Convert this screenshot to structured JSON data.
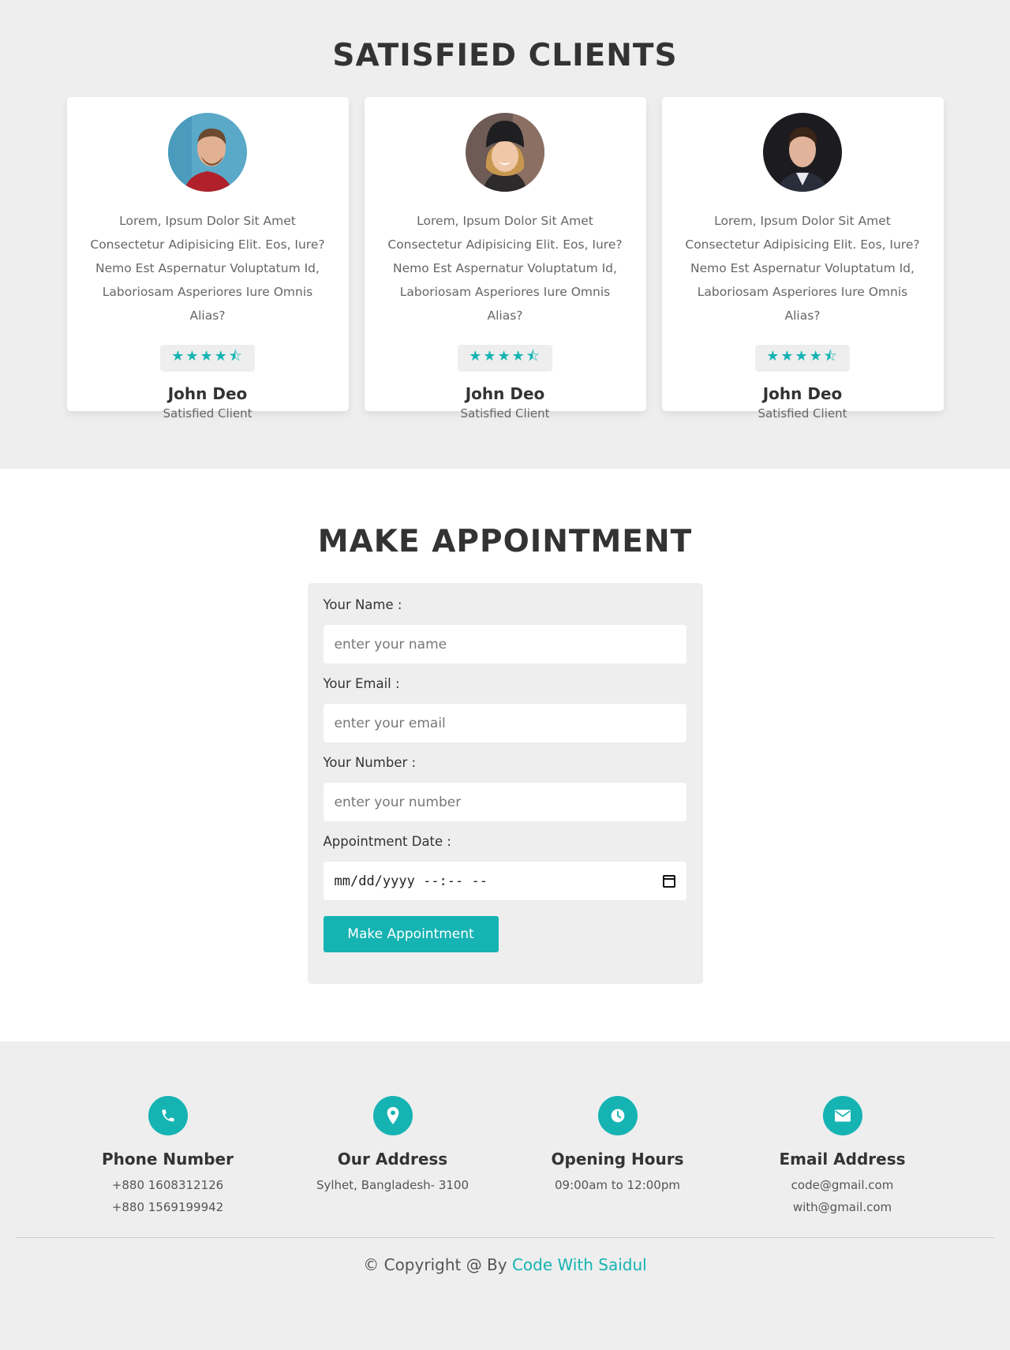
{
  "clients": {
    "title": "SATISFIED CLIENTS",
    "cards": [
      {
        "text": "Lorem, Ipsum Dolor Sit Amet Consectetur Adipisicing Elit. Eos, Iure? Nemo Est Aspernatur Voluptatum Id, Laboriosam Asperiores Iure Omnis Alias?",
        "rating": 4.5,
        "stars": "★★★★⯪",
        "name": "John Deo",
        "role": "Satisfied Client"
      },
      {
        "text": "Lorem, Ipsum Dolor Sit Amet Consectetur Adipisicing Elit. Eos, Iure? Nemo Est Aspernatur Voluptatum Id, Laboriosam Asperiores Iure Omnis Alias?",
        "rating": 4.5,
        "stars": "★★★★⯪",
        "name": "John Deo",
        "role": "Satisfied Client"
      },
      {
        "text": "Lorem, Ipsum Dolor Sit Amet Consectetur Adipisicing Elit. Eos, Iure? Nemo Est Aspernatur Voluptatum Id, Laboriosam Asperiores Iure Omnis Alias?",
        "rating": 4.5,
        "stars": "★★★★⯪",
        "name": "John Deo",
        "role": "Satisfied Client"
      }
    ]
  },
  "appointment": {
    "title": "MAKE APPOINTMENT",
    "name_label": "Your Name :",
    "name_placeholder": "enter your name",
    "email_label": "Your Email :",
    "email_placeholder": "enter your email",
    "number_label": "Your Number :",
    "number_placeholder": "enter your number",
    "date_label": "Appointment Date :",
    "date_placeholder": "mm/dd/yyyy --:-- --",
    "button_label": "Make Appointment"
  },
  "footer": {
    "items": [
      {
        "icon": "phone-icon",
        "title": "Phone Number",
        "lines": [
          "+880 1608312126",
          "+880 1569199942"
        ]
      },
      {
        "icon": "map-pin-icon",
        "title": "Our Address",
        "lines": [
          "Sylhet, Bangladesh- 3100"
        ]
      },
      {
        "icon": "clock-icon",
        "title": "Opening Hours",
        "lines": [
          "09:00am to 12:00pm"
        ]
      },
      {
        "icon": "envelope-icon",
        "title": "Email Address",
        "lines": [
          "code@gmail.com",
          "with@gmail.com"
        ]
      }
    ],
    "copyright_prefix": "© Copyright @ By",
    "copyright_link": "Code With Saidul"
  },
  "colors": {
    "accent": "#16b3b3",
    "section_bg": "#eeeeee"
  }
}
